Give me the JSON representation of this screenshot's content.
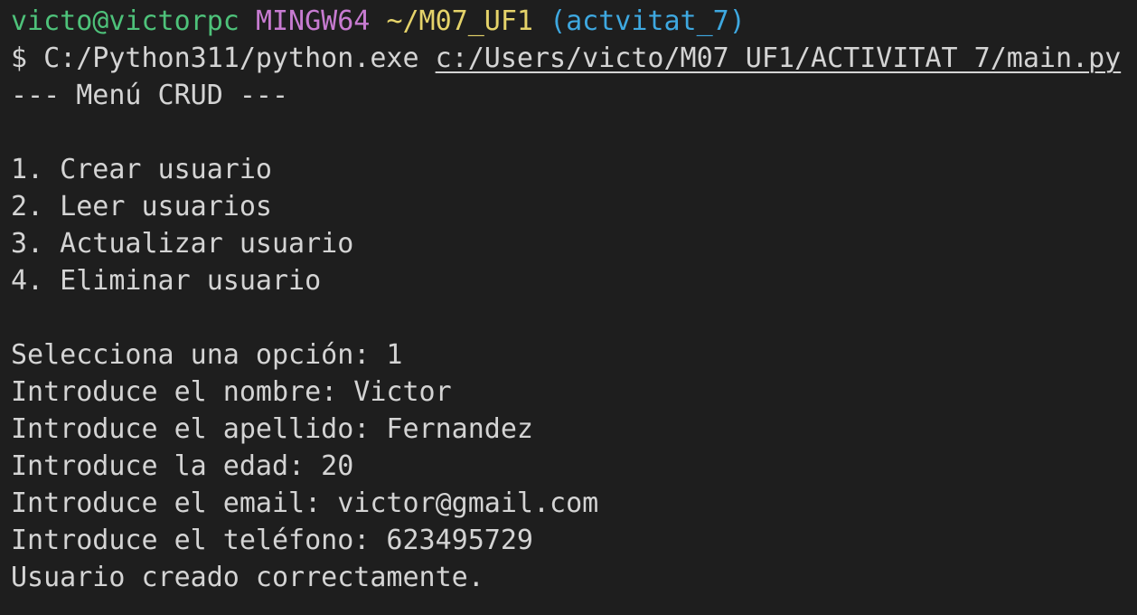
{
  "prompt": {
    "user_host": "victo@victorpc",
    "env": "MINGW64",
    "path": "~/M07_UF1",
    "branch": "(actvitat_7)",
    "symbol": "$",
    "command": "C:/Python311/python.exe",
    "script_path": "c:/Users/victo/M07_UF1/ACTIVITAT_7/main.py"
  },
  "output": {
    "menu_title": "--- Menú CRUD ---",
    "options": [
      "1. Crear usuario",
      "2. Leer usuarios",
      "3. Actualizar usuario",
      "4. Eliminar usuario"
    ],
    "session": [
      "Selecciona una opción: 1",
      "Introduce el nombre: Victor",
      "Introduce el apellido: Fernandez",
      "Introduce la edad: 20",
      "Introduce el email: victor@gmail.com",
      "Introduce el teléfono: 623495729",
      "Usuario creado correctamente."
    ]
  },
  "colors": {
    "background": "#1e1e1e",
    "text": "#d4d4d4",
    "user_host": "#4ec27a",
    "env": "#c77bd1",
    "path": "#e5d36a",
    "branch": "#3ea8e0"
  }
}
